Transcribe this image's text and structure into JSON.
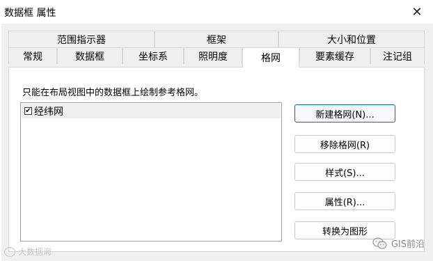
{
  "window": {
    "title": "数据框 属性",
    "close_glyph": "✕"
  },
  "tabs": {
    "row_top": [
      {
        "label": "范围指示器"
      },
      {
        "label": "框架"
      },
      {
        "label": "大小和位置"
      }
    ],
    "row_bottom": [
      {
        "label": "常规"
      },
      {
        "label": "数据框"
      },
      {
        "label": "坐标系"
      },
      {
        "label": "照明度"
      },
      {
        "label": "格网",
        "active": true
      },
      {
        "label": "要素缓存"
      },
      {
        "label": "注记组"
      }
    ]
  },
  "panel": {
    "instruction": "只能在布局视图中的数据框上绘制参考格网。",
    "grid_list": [
      {
        "label": "经纬网",
        "checked": true
      }
    ],
    "buttons": {
      "new_grid": "新建格网(N)...",
      "remove_grid": "移除格网(R)",
      "style": "样式(S)...",
      "properties": "属性(R)...",
      "convert": "转换为图形"
    }
  },
  "watermarks": {
    "left": "大数据海",
    "right": "GIS前沿"
  },
  "icons": {
    "close": "close-icon",
    "checkbox": "checkbox-checked-icon",
    "wechat": "wechat-icon"
  }
}
